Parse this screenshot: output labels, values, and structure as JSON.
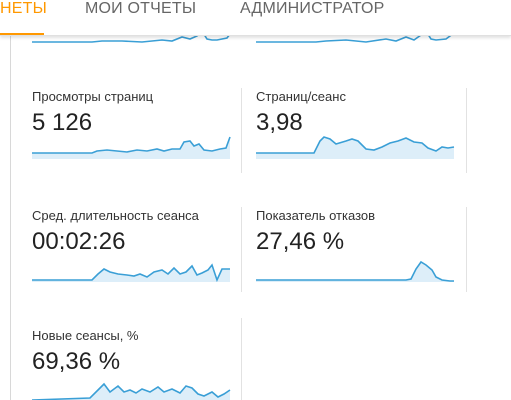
{
  "tabs": [
    {
      "label": "НЕТЫ",
      "active": true
    },
    {
      "label": "МОИ ОТЧЕТЫ",
      "active": false
    },
    {
      "label": "АДМИНИСТРАТОР",
      "active": false
    }
  ],
  "colors": {
    "accent": "#ff9800",
    "sparkline": "#3a9fd6",
    "sparkline_fill": "#ddeef9"
  },
  "metrics": [
    {
      "title": "Просмотры страниц",
      "value": "5 126"
    },
    {
      "title": "Страниц/сеанс",
      "value": "3,98"
    },
    {
      "title": "Сред. длительность сеанса",
      "value": "00:02:26"
    },
    {
      "title": "Показатель отказов",
      "value": "27,46 %"
    },
    {
      "title": "Новые сеансы, %",
      "value": "69,36 %"
    }
  ]
}
